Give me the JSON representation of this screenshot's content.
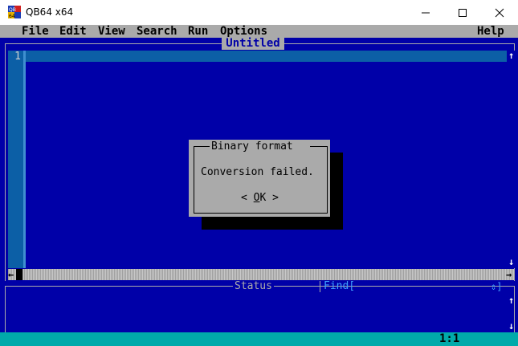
{
  "window": {
    "title": "QB64 x64",
    "icon_text": "QB64",
    "buttons": {
      "minimize": "—",
      "maximize": "☐",
      "close": "✕"
    }
  },
  "menubar": {
    "items": [
      "File",
      "Edit",
      "View",
      "Search",
      "Run",
      "Options"
    ],
    "help": "Help"
  },
  "editor": {
    "document_title": "Untitled",
    "line_numbers": [
      "1"
    ]
  },
  "status_panel": {
    "label": "Status",
    "find_label": "Find[",
    "find_toggle": "⇕]"
  },
  "statusbar": {
    "cursor_position": "1:1"
  },
  "dialog": {
    "title": "Binary format",
    "message": "Conversion failed.",
    "ok_left": "< ",
    "ok_underlined": "O",
    "ok_rest": "K",
    "ok_right": " >"
  },
  "colors": {
    "ide_background": "#0000a8",
    "menu_background": "#aaaaaa",
    "status_background": "#00aaaa"
  }
}
